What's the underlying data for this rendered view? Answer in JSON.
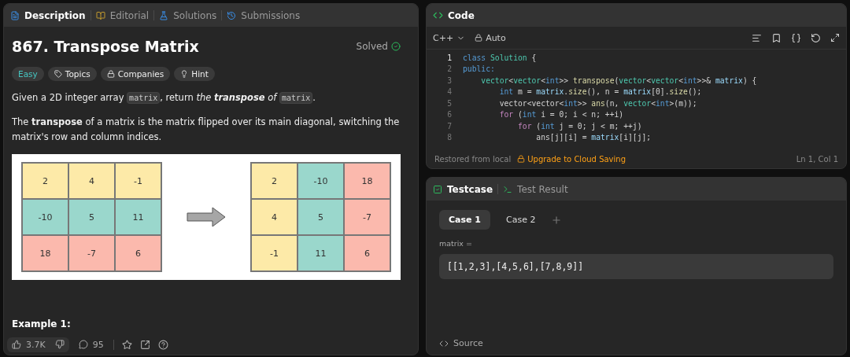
{
  "left_tabs": [
    {
      "label": "Description",
      "selected": true,
      "kind": "description"
    },
    {
      "label": "Editorial",
      "selected": false,
      "kind": "editorial"
    },
    {
      "label": "Solutions",
      "selected": false,
      "kind": "solutions"
    },
    {
      "label": "Submissions",
      "selected": false,
      "kind": "submissions"
    }
  ],
  "problem": {
    "title": "867. Transpose Matrix",
    "status": "Solved",
    "difficulty": "Easy",
    "chips": [
      {
        "label": "Topics",
        "kind": "topics"
      },
      {
        "label": "Companies",
        "kind": "companies"
      },
      {
        "label": "Hint",
        "kind": "hint"
      }
    ],
    "statement": [
      {
        "kind": "text",
        "text": "Given a 2D integer array "
      },
      {
        "kind": "code",
        "text": "matrix"
      },
      {
        "kind": "text",
        "text": ", return "
      },
      {
        "kind": "italic",
        "text": "the **transpose** of "
      },
      {
        "kind": "code",
        "text": "matrix"
      },
      {
        "kind": "text",
        "text": "."
      }
    ],
    "definition": "The **transpose** of a matrix is the matrix flipped over its main diagonal, switching the matrix's row and column indices.",
    "figure": {
      "before_rows": [
        {
          "color": "#fdeaa8",
          "cells": [
            "2",
            "4",
            "-1"
          ]
        },
        {
          "color": "#9ad7cc",
          "cells": [
            "-10",
            "5",
            "11"
          ]
        },
        {
          "color": "#fbb9ad",
          "cells": [
            "18",
            "-7",
            "6"
          ]
        }
      ],
      "after_columns": [
        {
          "color": "#fdeaa8",
          "cells": [
            "2",
            "4",
            "-1"
          ]
        },
        {
          "color": "#9ad7cc",
          "cells": [
            "-10",
            "5",
            "11"
          ]
        },
        {
          "color": "#fbb9ad",
          "cells": [
            "18",
            "-7",
            "6"
          ]
        }
      ]
    },
    "example_heading": "Example 1:"
  },
  "footer": {
    "likes": "3.7K",
    "comments": "95"
  },
  "code_panel": {
    "title": "Code",
    "language": "C++",
    "mode": "Auto",
    "lines": [
      {
        "number": "1",
        "current": true,
        "tokens": [
          {
            "kind": "kw",
            "text": "class "
          },
          {
            "kind": "type",
            "text": "Solution"
          },
          {
            "kind": "plain",
            "text": " {"
          }
        ]
      },
      {
        "number": "2",
        "current": false,
        "tokens": [
          {
            "kind": "kw",
            "text": "public:"
          }
        ]
      },
      {
        "number": "3",
        "current": false,
        "tokens": [
          {
            "kind": "type",
            "text": "    vector"
          },
          {
            "kind": "plain",
            "text": "<"
          },
          {
            "kind": "type",
            "text": "vector"
          },
          {
            "kind": "plain",
            "text": "<"
          },
          {
            "kind": "kw",
            "text": "int"
          },
          {
            "kind": "plain",
            "text": ">> "
          },
          {
            "kind": "func",
            "text": "transpose"
          },
          {
            "kind": "plain",
            "text": "("
          },
          {
            "kind": "type",
            "text": "vector"
          },
          {
            "kind": "plain",
            "text": "<"
          },
          {
            "kind": "type",
            "text": "vector"
          },
          {
            "kind": "plain",
            "text": "<"
          },
          {
            "kind": "kw",
            "text": "int"
          },
          {
            "kind": "plain",
            "text": ">>& "
          },
          {
            "kind": "var",
            "text": "matrix"
          },
          {
            "kind": "plain",
            "text": ") {"
          }
        ]
      },
      {
        "number": "4",
        "current": false,
        "tokens": [
          {
            "kind": "kw",
            "text": "        int"
          },
          {
            "kind": "plain",
            "text": " m = "
          },
          {
            "kind": "var",
            "text": "matrix"
          },
          {
            "kind": "plain",
            "text": "."
          },
          {
            "kind": "func",
            "text": "size"
          },
          {
            "kind": "plain",
            "text": "(), n = "
          },
          {
            "kind": "var",
            "text": "matrix"
          },
          {
            "kind": "plain",
            "text": "[0]."
          },
          {
            "kind": "func",
            "text": "size"
          },
          {
            "kind": "plain",
            "text": "();"
          }
        ]
      },
      {
        "number": "5",
        "current": false,
        "tokens": [
          {
            "kind": "plain",
            "text": "        vector<vector<"
          },
          {
            "kind": "kw",
            "text": "int"
          },
          {
            "kind": "plain",
            "text": ">> "
          },
          {
            "kind": "func",
            "text": "ans"
          },
          {
            "kind": "plain",
            "text": "(n, "
          },
          {
            "kind": "type",
            "text": "vector"
          },
          {
            "kind": "plain",
            "text": "<"
          },
          {
            "kind": "kw",
            "text": "int"
          },
          {
            "kind": "plain",
            "text": ">(m));"
          }
        ]
      },
      {
        "number": "6",
        "current": false,
        "tokens": [
          {
            "kind": "ctl",
            "text": "        for"
          },
          {
            "kind": "plain",
            "text": " ("
          },
          {
            "kind": "kw",
            "text": "int"
          },
          {
            "kind": "plain",
            "text": " i = 0; i < n; ++i)"
          }
        ]
      },
      {
        "number": "7",
        "current": false,
        "tokens": [
          {
            "kind": "ctl",
            "text": "            for"
          },
          {
            "kind": "plain",
            "text": " ("
          },
          {
            "kind": "kw",
            "text": "int"
          },
          {
            "kind": "plain",
            "text": " j = 0; j < m; ++j)"
          }
        ]
      },
      {
        "number": "8",
        "current": false,
        "tokens": [
          {
            "kind": "plain",
            "text": "                ans[j][i] = "
          },
          {
            "kind": "var",
            "text": "matrix"
          },
          {
            "kind": "plain",
            "text": "[i][j];"
          }
        ]
      }
    ],
    "restored": "Restored from local",
    "upgrade": "Upgrade to Cloud Saving",
    "cursor": "Ln 1, Col 1"
  },
  "test_panel": {
    "tabs": [
      {
        "label": "Testcase",
        "selected": true,
        "kind": "testcase"
      },
      {
        "label": "Test Result",
        "selected": false,
        "kind": "result"
      }
    ],
    "cases": [
      {
        "label": "Case 1",
        "selected": true
      },
      {
        "label": "Case 2",
        "selected": false
      }
    ],
    "param_label": "matrix =",
    "param_value": "[[1,2,3],[4,5,6],[7,8,9]]",
    "source": "Source"
  }
}
